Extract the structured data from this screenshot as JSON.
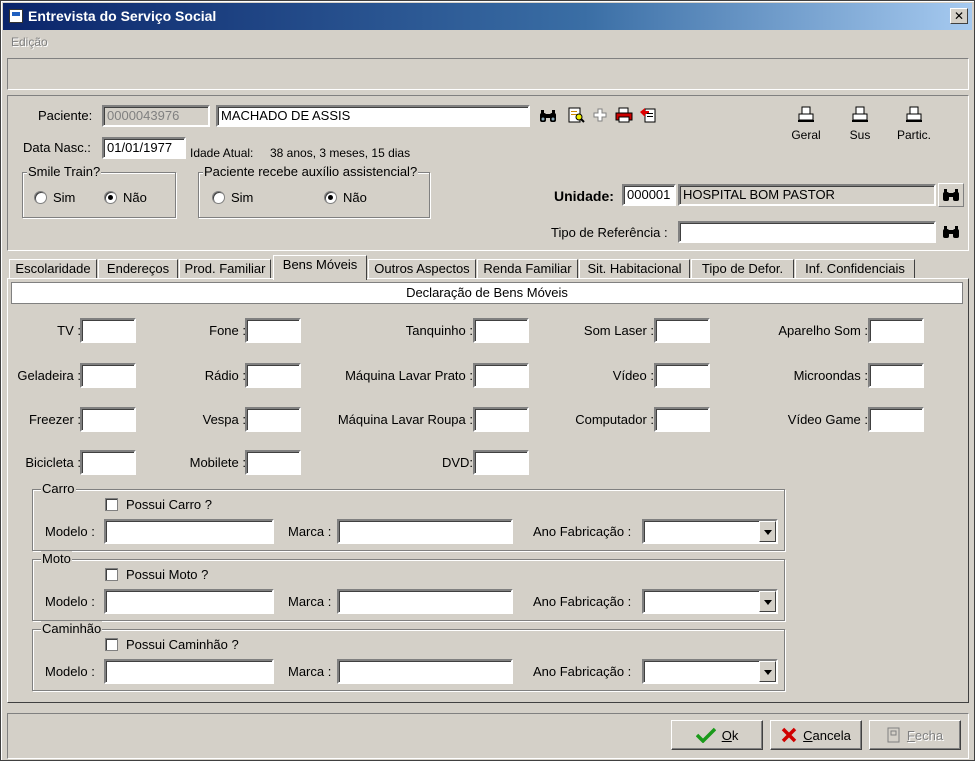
{
  "window": {
    "title": "Entrevista do Serviço Social"
  },
  "menu": {
    "items": [
      {
        "label": "Edição"
      }
    ]
  },
  "patient": {
    "label": "Paciente:",
    "id": "0000043976",
    "name": "MACHADO DE ASSIS",
    "birth_label": "Data Nasc.:",
    "birth": "01/01/1977",
    "age_label": "Idade Atual:",
    "age": "38 anos, 3 meses, 15 dias"
  },
  "toolbar_icons": [
    "binoculars-icon",
    "document-search-icon",
    "add-icon",
    "printer-icon",
    "document-red-icon"
  ],
  "print_buttons": [
    {
      "label": "Geral"
    },
    {
      "label": "Sus"
    },
    {
      "label": "Partic."
    }
  ],
  "smile_train": {
    "title": "Smile Train?",
    "options": [
      "Sim",
      "Não"
    ],
    "selected": "Não"
  },
  "assistance": {
    "title": "Paciente recebe auxílio assistencial?",
    "options": [
      "Sim",
      "Não"
    ],
    "selected": "Não"
  },
  "unit": {
    "label": "Unidade:",
    "code": "000001",
    "name": "HOSPITAL BOM PASTOR"
  },
  "referral": {
    "label": "Tipo de Referência :",
    "value": ""
  },
  "tabs": [
    "Escolaridade",
    "Endereços",
    "Prod. Familiar",
    "Bens Móveis",
    "Outros Aspectos",
    "Renda Familiar",
    "Sit. Habitacional",
    "Tipo de Defor.",
    "Inf. Confidenciais"
  ],
  "active_tab": "Bens Móveis",
  "section_title": "Declaração de Bens Móveis",
  "goods": {
    "col1": [
      "TV :",
      "Geladeira :",
      "Freezer :",
      "Bicicleta :"
    ],
    "col2": [
      "Fone :",
      "Rádio :",
      "Vespa :",
      "Mobilete :"
    ],
    "col3": [
      "Tanquinho :",
      "Máquina Lavar Prato :",
      "Máquina Lavar Roupa :",
      "DVD:"
    ],
    "col4": [
      "Som Laser :",
      "Vídeo :",
      "Computador :"
    ],
    "col5": [
      "Aparelho Som :",
      "Microondas :",
      "Vídeo Game :"
    ]
  },
  "vehicles": [
    {
      "title": "Carro",
      "checkbox": "Possui Carro ?",
      "model_label": "Modelo :",
      "brand_label": "Marca :",
      "year_label": "Ano Fabricação :"
    },
    {
      "title": "Moto",
      "checkbox": "Possui Moto ?",
      "model_label": "Modelo :",
      "brand_label": "Marca :",
      "year_label": "Ano Fabricação :"
    },
    {
      "title": "Caminhão",
      "checkbox": "Possui Caminhão ?",
      "model_label": "Modelo :",
      "brand_label": "Marca :",
      "year_label": "Ano Fabricação :"
    }
  ],
  "buttons": {
    "ok": {
      "label": "Ok",
      "accel": "O",
      "rest": "k"
    },
    "cancel": {
      "label": "Cancela",
      "accel": "C",
      "rest": "ancela"
    },
    "close": {
      "label": "Fecha",
      "accel": "F",
      "rest": "echa"
    }
  },
  "colors": {
    "title_start": "#0a246a",
    "title_end": "#a6caf0",
    "face": "#d4d0c8"
  }
}
